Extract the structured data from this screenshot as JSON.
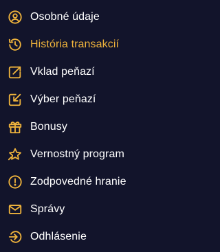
{
  "menu": {
    "items": [
      {
        "label": "Osobné údaje",
        "icon": "user-circle-icon",
        "active": false
      },
      {
        "label": "História transakcií",
        "icon": "history-icon",
        "active": true
      },
      {
        "label": "Vklad peňazí",
        "icon": "wallet-deposit-icon",
        "active": false
      },
      {
        "label": "Výber peňazí",
        "icon": "wallet-withdraw-icon",
        "active": false
      },
      {
        "label": "Bonusy",
        "icon": "gift-icon",
        "active": false
      },
      {
        "label": "Vernostný program",
        "icon": "loyalty-star-icon",
        "active": false
      },
      {
        "label": "Zodpovedné hranie",
        "icon": "alert-circle-icon",
        "active": false
      },
      {
        "label": "Správy",
        "icon": "envelope-icon",
        "active": false
      },
      {
        "label": "Odhlásenie",
        "icon": "logout-icon",
        "active": false
      }
    ]
  },
  "colors": {
    "background": "#12142b",
    "accent": "#f0b43c",
    "text": "#ffffff"
  }
}
